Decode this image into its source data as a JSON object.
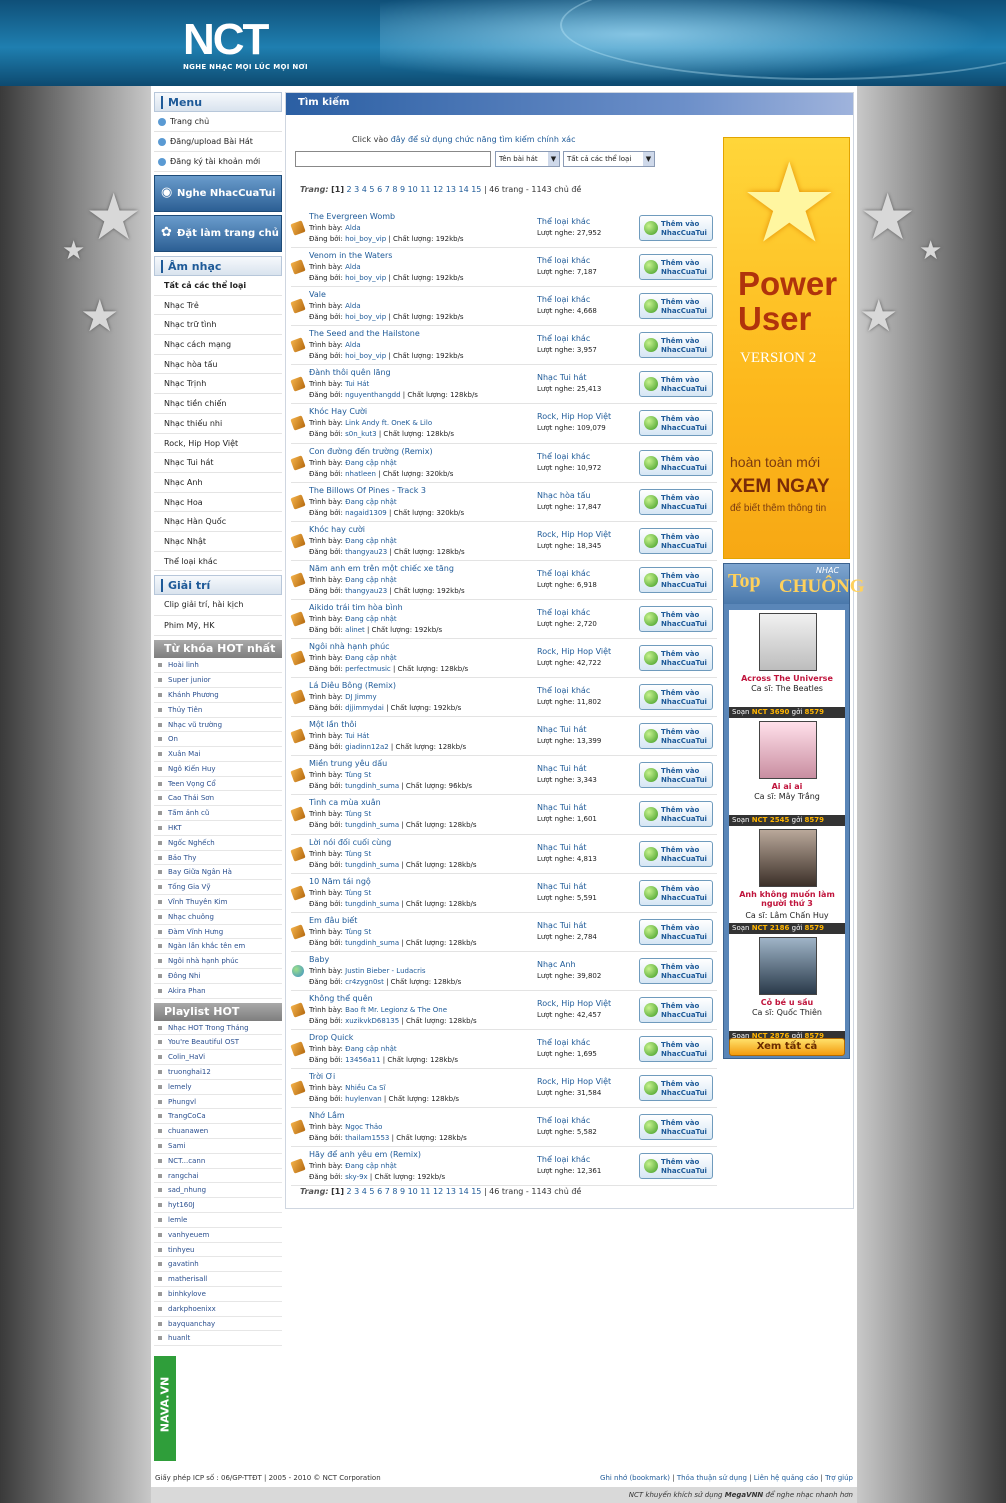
{
  "header": {
    "logo": "NCT",
    "slogan": "NGHE NHẠC MỌI LÚC MỌI NƠI"
  },
  "left": {
    "menu_title": "Menu",
    "menu_items": [
      "Trang chủ",
      "Đăng/upload Bài Hát",
      "Đăng ký tài khoản mới"
    ],
    "btn_listen": "Nghe NhacCuaTui",
    "btn_home": "Đặt làm trang chủ",
    "music_title": "Âm nhạc",
    "music_items": [
      "Tất cả các thể loại",
      "Nhạc Trẻ",
      "Nhạc trữ tình",
      "Nhạc cách mạng",
      "Nhạc hòa tấu",
      "Nhạc Trịnh",
      "Nhạc tiền chiến",
      "Nhạc thiếu nhi",
      "Rock, Hip Hop Việt",
      "Nhạc Tui hát",
      "Nhạc Anh",
      "Nhạc Hoa",
      "Nhạc Hàn Quốc",
      "Nhạc Nhật",
      "Thể loại khác"
    ],
    "ent_title": "Giải trí",
    "ent_items": [
      "Clip giải trí, hài kịch",
      "Phim Mỹ, HK"
    ],
    "hot_title": "Từ khóa HOT nhất",
    "hot_items": [
      "Hoài linh",
      "Super junior",
      "Khánh Phương",
      "Thủy Tiên",
      "Nhạc vũ trường",
      "On",
      "Xuân Mai",
      "Ngô Kiến Huy",
      "Teen Vọng Cổ",
      "Cao Thái Sơn",
      "Tấm ảnh cũ",
      "HKT",
      "Ngốc Nghếch",
      "Bảo Thy",
      "Bay Giữa Ngân Hà",
      "Tống Gia Vỹ",
      "Vĩnh Thuyên Kim",
      "Nhạc chuông",
      "Đàm Vĩnh Hưng",
      "Ngàn lần khắc tên em",
      "Ngôi nhà hạnh phúc",
      "Đông Nhi",
      "Akira Phan"
    ],
    "playlist_title": "Playlist HOT",
    "playlist_items": [
      "Nhạc HOT Trong Tháng",
      "You're Beautiful OST",
      "Colin_HaVi",
      "truonghai12",
      "lemely",
      "Phungvl",
      "TrangCoCa",
      "chuanawen",
      "Sami",
      "NCT...cann",
      "rangchai",
      "sad_nhung",
      "hyt160J",
      "lemle",
      "vanhyeuem",
      "tinhyeu",
      "gavatinh",
      "matherisall",
      "binhkylove",
      "darkphoenixx",
      "bayquanchay",
      "huanlt"
    ],
    "nava": "NAVA.VN"
  },
  "main": {
    "title": "Tìm kiếm",
    "hint_prefix": "Click vào ",
    "hint_link": "đây để sử dụng chức năng tìm kiếm chính xác",
    "search_value": "",
    "select1": "Tên bài hát",
    "select2": "Tất cả các thể loại",
    "pager_label": "Trang:",
    "pager_current": "[1]",
    "pager_pages": "2 3 4 5 6 7 8 9 10 11 12 13 14 15",
    "pager_total": "| 46 trang - 1143 chủ đề",
    "add_button": "Thêm vào NhacCuaTui",
    "artist_label": "Trình bày:",
    "upload_label": "Đăng bởi:",
    "quality_label": "| Chất lượng:",
    "views_label": "Lượt nghe:",
    "songs": [
      {
        "title": "The Evergreen Womb",
        "artist": "Alda",
        "uploader": "hoi_boy_vip",
        "quality": "192kb/s",
        "genre": "Thể loại khác",
        "views": "27,952",
        "icon": "music"
      },
      {
        "title": "Venom in the Waters",
        "artist": "Alda",
        "uploader": "hoi_boy_vip",
        "quality": "192kb/s",
        "genre": "Thể loại khác",
        "views": "7,187",
        "icon": "music"
      },
      {
        "title": "Vale",
        "artist": "Alda",
        "uploader": "hoi_boy_vip",
        "quality": "192kb/s",
        "genre": "Thể loại khác",
        "views": "4,668",
        "icon": "music"
      },
      {
        "title": "The Seed and the Hailstone",
        "artist": "Alda",
        "uploader": "hoi_boy_vip",
        "quality": "192kb/s",
        "genre": "Thể loại khác",
        "views": "3,957",
        "icon": "music"
      },
      {
        "title": "Đành thôi quên lãng",
        "artist": "Tui Hát",
        "uploader": "nguyenthangdd",
        "quality": "128kb/s",
        "genre": "Nhạc Tui hát",
        "views": "25,413",
        "icon": "music"
      },
      {
        "title": "Khóc Hay Cười",
        "artist": "Link Andy ft. OneK & Lilo",
        "uploader": "s0n_kut3",
        "quality": "128kb/s",
        "genre": "Rock, Hip Hop Việt",
        "views": "109,079",
        "icon": "music"
      },
      {
        "title": "Con đường đến trường (Remix)",
        "artist": "Đang cập nhật",
        "uploader": "nhatleen",
        "quality": "320kb/s",
        "genre": "Thể loại khác",
        "views": "10,972",
        "icon": "music"
      },
      {
        "title": "The Billows Of Pines - Track 3",
        "artist": "Đang cập nhật",
        "uploader": "nagaid1309",
        "quality": "320kb/s",
        "genre": "Nhạc hòa tấu",
        "views": "17,847",
        "icon": "music"
      },
      {
        "title": "Khóc hay cười",
        "artist": "Đang cập nhật",
        "uploader": "thangyau23",
        "quality": "128kb/s",
        "genre": "Rock, Hip Hop Việt",
        "views": "18,345",
        "icon": "music"
      },
      {
        "title": "Năm anh em trên một chiếc xe tăng",
        "artist": "Đang cập nhật",
        "uploader": "thangyau23",
        "quality": "192kb/s",
        "genre": "Thể loại khác",
        "views": "6,918",
        "icon": "music"
      },
      {
        "title": "Aikido trái tim hòa bình",
        "artist": "Đang cập nhật",
        "uploader": "alinet",
        "quality": "192kb/s",
        "genre": "Thể loại khác",
        "views": "2,720",
        "icon": "music"
      },
      {
        "title": "Ngôi nhà hạnh phúc",
        "artist": "Đang cập nhật",
        "uploader": "perfectmusic",
        "quality": "128kb/s",
        "genre": "Rock, Hip Hop Việt",
        "views": "42,722",
        "icon": "music"
      },
      {
        "title": "Lá Diêu Bông (Remix)",
        "artist": "DJ Jimmy",
        "uploader": "djjimmydai",
        "quality": "192kb/s",
        "genre": "Thể loại khác",
        "views": "11,802",
        "icon": "music"
      },
      {
        "title": "Một lần thôi",
        "artist": "Tui Hát",
        "uploader": "giadinn12a2",
        "quality": "128kb/s",
        "genre": "Nhạc Tui hát",
        "views": "13,399",
        "icon": "music"
      },
      {
        "title": "Miền trung yêu dấu",
        "artist": "Tùng St",
        "uploader": "tungdinh_suma",
        "quality": "96kb/s",
        "genre": "Nhạc Tui hát",
        "views": "3,343",
        "icon": "music"
      },
      {
        "title": "Tình ca mùa xuân",
        "artist": "Tùng St",
        "uploader": "tungdinh_suma",
        "quality": "128kb/s",
        "genre": "Nhạc Tui hát",
        "views": "1,601",
        "icon": "music"
      },
      {
        "title": "Lời nói đối cuối cùng",
        "artist": "Tùng St",
        "uploader": "tungdinh_suma",
        "quality": "128kb/s",
        "genre": "Nhạc Tui hát",
        "views": "4,813",
        "icon": "music"
      },
      {
        "title": "10 Năm tái ngộ",
        "artist": "Tùng St",
        "uploader": "tungdinh_suma",
        "quality": "128kb/s",
        "genre": "Nhạc Tui hát",
        "views": "5,591",
        "icon": "music"
      },
      {
        "title": "Em đâu biết",
        "artist": "Tùng St",
        "uploader": "tungdinh_suma",
        "quality": "128kb/s",
        "genre": "Nhạc Tui hát",
        "views": "2,784",
        "icon": "music"
      },
      {
        "title": "Baby",
        "artist": "Justin Bieber - Ludacris",
        "uploader": "cr4zygn0st",
        "quality": "128kb/s",
        "genre": "Nhạc Anh",
        "views": "39,802",
        "icon": "video"
      },
      {
        "title": "Không thể quên",
        "artist": "Bao ft Mr. Legionz & The One",
        "uploader": "xuzikvkD68135",
        "quality": "128kb/s",
        "genre": "Rock, Hip Hop Việt",
        "views": "42,457",
        "icon": "music"
      },
      {
        "title": "Drop Quick",
        "artist": "Đang cập nhật",
        "uploader": "13456a11",
        "quality": "128kb/s",
        "genre": "Thể loại khác",
        "views": "1,695",
        "icon": "music"
      },
      {
        "title": "Trời Ơi",
        "artist": "Nhiều Ca Sĩ",
        "uploader": "huylenvan",
        "quality": "128kb/s",
        "genre": "Rock, Hip Hop Việt",
        "views": "31,584",
        "icon": "music"
      },
      {
        "title": "Nhớ Lắm",
        "artist": "Ngọc Thảo",
        "uploader": "thailam1553",
        "quality": "128kb/s",
        "genre": "Thể loại khác",
        "views": "5,582",
        "icon": "music"
      },
      {
        "title": "Hãy để anh yêu em (Remix)",
        "artist": "Đang cập nhật",
        "uploader": "sky-9x",
        "quality": "192kb/s",
        "genre": "Thể loại khác",
        "views": "12,361",
        "icon": "music"
      }
    ]
  },
  "ad_power": {
    "title1": "Power",
    "title2": "User",
    "version": "VERSION 2",
    "new": "hoàn toàn mới",
    "see": "XEM NGAY",
    "more": "để biết thêm thông tin"
  },
  "top_chuong": {
    "title_top": "Top",
    "title_nhac": "NHẠC",
    "title_chuong": "CHUÔNG",
    "sms_prefix": "Soạn",
    "sms_mid": "gởi",
    "items": [
      {
        "name": "Across The Universe",
        "singer": "Ca sĩ: The Beatles",
        "code": "NCT 3690",
        "num": "8579",
        "photo": "beatles"
      },
      {
        "name": "Ai ai ai",
        "singer": "Ca sĩ: Mây Trắng",
        "code": "NCT 2545",
        "num": "8579",
        "photo": "girls"
      },
      {
        "name": "Anh không muốn làm người thứ 3",
        "singer": "Ca sĩ: Lâm Chấn Huy",
        "code": "NCT 2186",
        "num": "8579",
        "photo": "guy1"
      },
      {
        "name": "Cỏ bé u sầu",
        "singer": "Ca sĩ: Quốc Thiên",
        "code": "NCT 2876",
        "num": "8579",
        "photo": "guy2"
      }
    ],
    "see_all": "Xem tất cả"
  },
  "footer": {
    "left": "Giấy phép ICP số : 06/GP-TTĐT | 2005 - 2010 © NCT Corporation",
    "links": [
      "Ghi nhớ (bookmark)",
      "Thỏa thuận sử dụng",
      "Liên hệ quảng cáo",
      "Trợ giúp"
    ],
    "bottom_prefix": "NCT khuyến khích sử dụng ",
    "bottom_brand": "MegaVNN",
    "bottom_suffix": " để nghe nhạc nhanh hơn"
  }
}
